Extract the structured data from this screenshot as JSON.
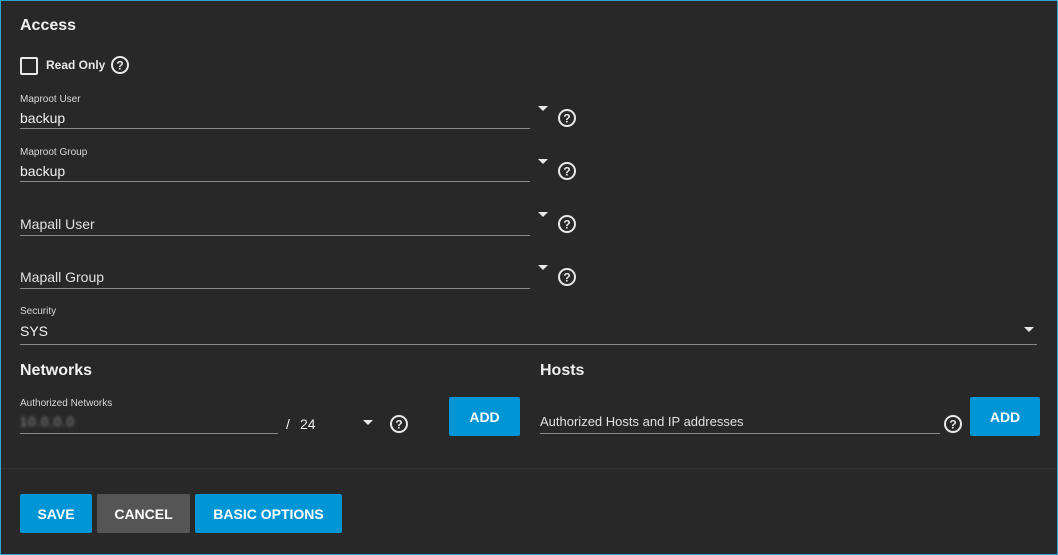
{
  "access": {
    "title": "Access",
    "read_only_label": "Read Only",
    "maproot_user": {
      "label": "Maproot User",
      "value": "backup"
    },
    "maproot_group": {
      "label": "Maproot Group",
      "value": "backup"
    },
    "mapall_user": {
      "placeholder": "Mapall User"
    },
    "mapall_group": {
      "placeholder": "Mapall Group"
    },
    "security": {
      "label": "Security",
      "value": "SYS"
    }
  },
  "networks": {
    "title": "Networks",
    "authorized_label": "Authorized Networks",
    "address_value": "10.0.0.0",
    "mask_separator": "/",
    "mask_value": "24",
    "add_label": "ADD"
  },
  "hosts": {
    "title": "Hosts",
    "placeholder": "Authorized Hosts and IP addresses",
    "add_label": "ADD"
  },
  "footer": {
    "save_label": "SAVE",
    "cancel_label": "CANCEL",
    "basic_options_label": "BASIC OPTIONS"
  },
  "colors": {
    "background": "#282828",
    "accent": "#0095d5",
    "secondary_button": "#555555",
    "frame_border": "#2aa7d6"
  }
}
